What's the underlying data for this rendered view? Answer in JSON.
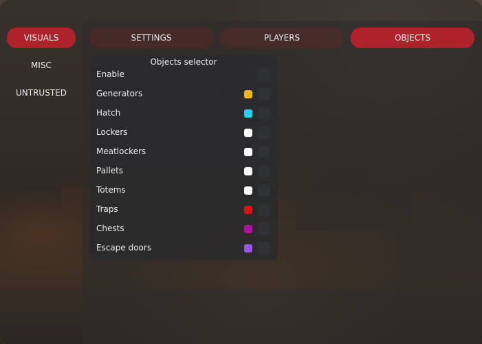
{
  "sidebar": {
    "items": [
      {
        "label": "VISUALS",
        "active": true
      },
      {
        "label": "MISC",
        "active": false
      },
      {
        "label": "UNTRUSTED",
        "active": false
      }
    ]
  },
  "tabs": [
    {
      "label": "SETTINGS",
      "active": false
    },
    {
      "label": "PLAYERS",
      "active": false
    },
    {
      "label": "OBJECTS",
      "active": true
    }
  ],
  "colors": {
    "accent": "#b0222b",
    "panel": "#2a2a2c",
    "checkbox": "#303133"
  },
  "objects_selector": {
    "title": "Objects selector",
    "rows": [
      {
        "label": "Enable",
        "color": null,
        "checked": false
      },
      {
        "label": "Generators",
        "color": "#f5b800",
        "checked": false
      },
      {
        "label": "Hatch",
        "color": "#1fd3ee",
        "checked": false
      },
      {
        "label": "Lockers",
        "color": "#ffffff",
        "checked": false
      },
      {
        "label": "Meatlockers",
        "color": "#ffffff",
        "checked": false
      },
      {
        "label": "Pallets",
        "color": "#ffffff",
        "checked": false
      },
      {
        "label": "Totems",
        "color": "#ffffff",
        "checked": false
      },
      {
        "label": "Traps",
        "color": "#dd1111",
        "checked": false
      },
      {
        "label": "Chests",
        "color": "#b5109f",
        "checked": false
      },
      {
        "label": "Escape doors",
        "color": "#9a55e6",
        "checked": false
      }
    ]
  }
}
